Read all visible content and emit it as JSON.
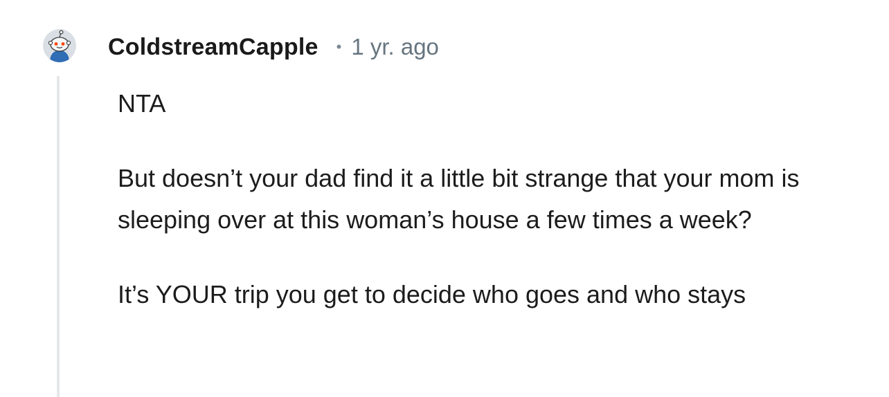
{
  "comment": {
    "username": "ColdstreamCapple",
    "separator": "•",
    "timestamp": "1 yr. ago",
    "paragraphs": [
      "NTA",
      "But doesn’t your dad find it a little bit strange that your mom is sleeping over at this woman’s house a few times a week?",
      "It’s YOUR trip you get to decide who goes and who stays"
    ]
  },
  "colors": {
    "text": "#1c1c1c",
    "meta": "#66757f",
    "thread_line": "#e5e7e9",
    "avatar_bg": "#d9dfe4",
    "avatar_shirt": "#2f6db5",
    "avatar_eye": "#ff4500"
  },
  "icons": {
    "avatar": "reddit-snoo-avatar-icon"
  }
}
